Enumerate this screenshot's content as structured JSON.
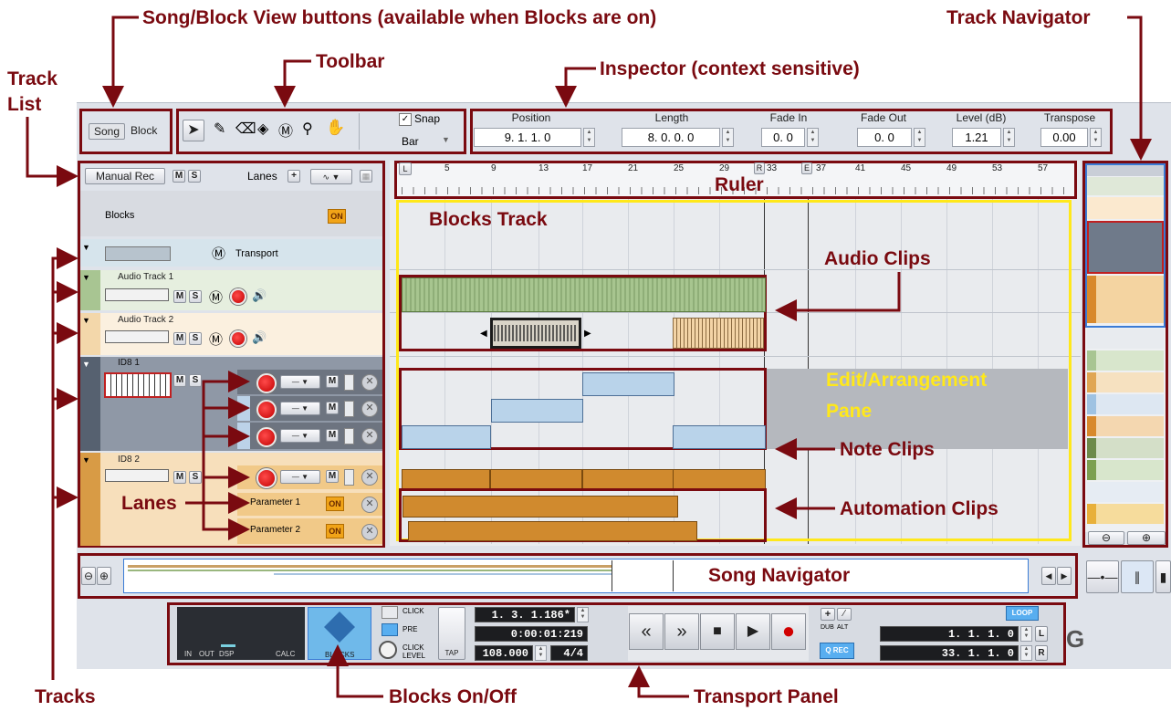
{
  "annotations": {
    "song_block_view": "Song/Block View buttons (available when Blocks are on)",
    "toolbar": "Toolbar",
    "inspector": "Inspector (context sensitive)",
    "track_navigator": "Track Navigator",
    "track_list_line1": "Track",
    "track_list_line2": "List",
    "ruler": "Ruler",
    "blocks_track": "Blocks Track",
    "audio_clips": "Audio Clips",
    "edit_pane_line1": "Edit/Arrangement",
    "edit_pane_line2": "Pane",
    "note_clips": "Note Clips",
    "lanes": "Lanes",
    "automation_clips": "Automation Clips",
    "song_navigator": "Song Navigator",
    "tracks": "Tracks",
    "blocks_onoff": "Blocks On/Off",
    "transport_panel": "Transport Panel"
  },
  "view_buttons": {
    "song": "Song",
    "block": "Block"
  },
  "toolbar": {
    "tools": [
      "arrow-tool",
      "pencil-tool",
      "eraser-tool",
      "paint-tool",
      "marker-tool",
      "zoom-tool",
      "hand-tool"
    ],
    "snap_label": "Snap",
    "snap_checked": true,
    "snap_value": "Bar"
  },
  "inspector": {
    "fields": [
      {
        "label": "Position",
        "value": "9. 1. 1.   0"
      },
      {
        "label": "Length",
        "value": "8. 0. 0.   0"
      },
      {
        "label": "Fade In",
        "value": "0.   0"
      },
      {
        "label": "Fade Out",
        "value": "0.   0"
      },
      {
        "label": "Level (dB)",
        "value": "1.21"
      },
      {
        "label": "Transpose",
        "value": "0.00"
      }
    ]
  },
  "track_list": {
    "manual_rec": "Manual Rec",
    "m": "M",
    "s": "S",
    "lanes_label": "Lanes",
    "lanes_plus": "+",
    "blocks_label": "Blocks",
    "on_badge": "ON",
    "transport_label": "Transport",
    "tracks": [
      {
        "name": "Audio Track 1"
      },
      {
        "name": "Audio Track 2"
      },
      {
        "name": "ID8 1"
      },
      {
        "name": "ID8 2"
      }
    ],
    "param_lanes": [
      "Parameter 1",
      "Parameter 2"
    ]
  },
  "ruler": {
    "markers": [
      "5",
      "9",
      "13",
      "17",
      "21",
      "25",
      "29",
      "33",
      "37",
      "41",
      "45",
      "49",
      "53",
      "57"
    ],
    "loop_left": "L",
    "loop_right": "R",
    "end_marker": "E"
  },
  "transport": {
    "meter_labels": [
      "IN",
      "OUT",
      "DSP",
      "CALC"
    ],
    "blocks_btn": "BLOCKS",
    "click": "CLICK",
    "pre": "PRE",
    "click_level_1": "CLICK",
    "click_level_2": "LEVEL",
    "tap": "TAP",
    "position": "1. 3. 1.186*",
    "time": "0:00:01:219",
    "tempo": "108.000",
    "time_sig": "4/4",
    "dub": "DUB",
    "alt": "ALT",
    "qrec": "Q REC",
    "loop": "LOOP",
    "loop_left": "1. 1. 1.    0",
    "loop_right": "33. 1. 1.    0",
    "l": "L",
    "r": "R"
  },
  "colors": {
    "annotation": "#7a0a10",
    "edit_pane_label": "#ffe81a",
    "audio_clip": "#a7c58f",
    "note_clip": "#b9d3ea",
    "automation_clip": "#d08a2e"
  }
}
